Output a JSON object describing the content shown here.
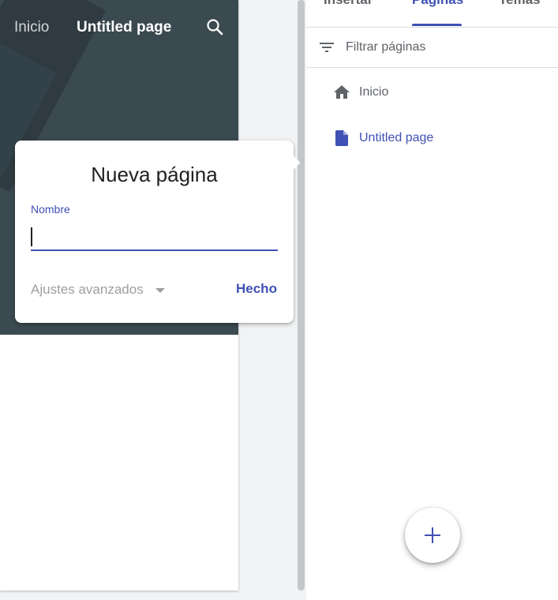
{
  "site_preview": {
    "nav": {
      "home_label": "Inicio",
      "current_label": "Untitled page",
      "search_icon": "search-icon"
    }
  },
  "dialog": {
    "title": "Nueva página",
    "name_label": "Nombre",
    "name_value": "",
    "advanced_label": "Ajustes avanzados",
    "done_label": "Hecho"
  },
  "panel": {
    "tabs": [
      {
        "label": "Insertar",
        "selected": false
      },
      {
        "label": "Páginas",
        "selected": true
      },
      {
        "label": "Temas",
        "selected": false
      }
    ],
    "filter": {
      "placeholder": "Filtrar páginas",
      "icon": "filter-icon"
    },
    "pages": [
      {
        "label": "Inicio",
        "icon": "home-icon",
        "active": false
      },
      {
        "label": "Untitled page",
        "icon": "page-icon",
        "active": true
      }
    ],
    "add_button_icon": "plus-icon"
  },
  "colors": {
    "accent": "#3f51b5",
    "hero_bg": "#3b4a50",
    "muted_text": "#5f6368"
  }
}
